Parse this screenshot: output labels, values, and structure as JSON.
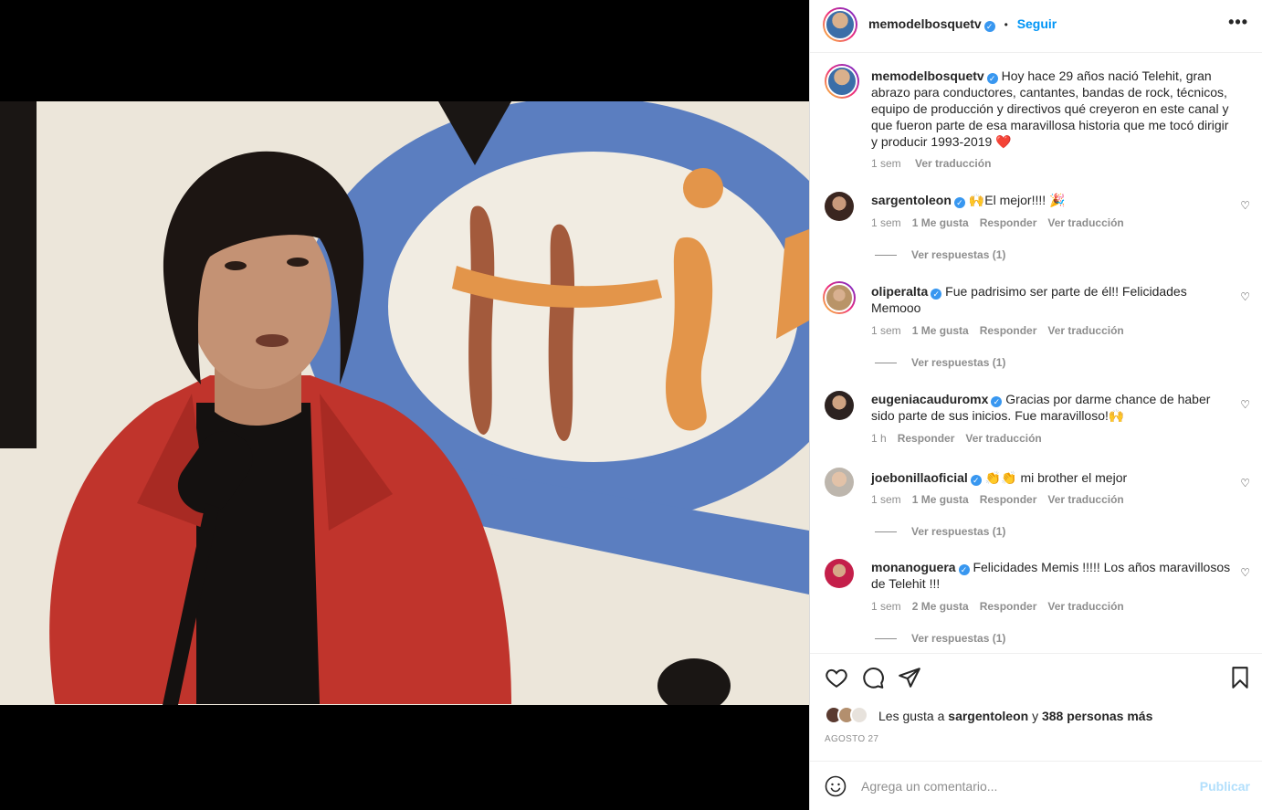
{
  "post": {
    "author": "memodelbosquetv",
    "follow_label": "Seguir",
    "dot": "•",
    "more_label": "•••"
  },
  "caption": {
    "author": "memodelbosquetv",
    "text": "Hoy hace 29 años nació Telehit, gran abrazo para conductores, cantantes, bandas de rock, técnicos, equipo de producción y directivos qué creyeron en este canal y que fueron parte de esa maravillosa historia que me tocó dirigir y producir 1993-2019 ❤️",
    "time": "1 sem",
    "translate": "Ver traducción"
  },
  "comments": [
    {
      "user": "sargentoleon",
      "text": "🙌El mejor!!!! 🎉",
      "time": "1 sem",
      "likes": "1 Me gusta",
      "reply": "Responder",
      "translate": "Ver traducción",
      "replies": "Ver respuestas (1)"
    },
    {
      "user": "oliperalta",
      "text": "Fue padrisimo ser parte de él!! Felicidades Memooo",
      "time": "1 sem",
      "likes": "1 Me gusta",
      "reply": "Responder",
      "translate": "Ver traducción",
      "replies": "Ver respuestas (1)"
    },
    {
      "user": "eugeniacauduromx",
      "text": "Gracias por darme chance de haber sido parte de sus inicios. Fue maravilloso!🙌",
      "time": "1 h",
      "likes": "",
      "reply": "Responder",
      "translate": "Ver traducción",
      "replies": ""
    },
    {
      "user": "joebonillaoficial",
      "text": "👏👏 mi brother el mejor",
      "time": "1 sem",
      "likes": "1 Me gusta",
      "reply": "Responder",
      "translate": "Ver traducción",
      "replies": "Ver respuestas (1)"
    },
    {
      "user": "monanoguera",
      "text": "Felicidades Memis !!!!! Los años maravillosos de Telehit !!!",
      "time": "1 sem",
      "likes": "2 Me gusta",
      "reply": "Responder",
      "translate": "Ver traducción",
      "replies": "Ver respuestas (1)"
    }
  ],
  "likes": {
    "prefix": "Les gusta a",
    "user": "sargentoleon",
    "joiner": "y",
    "others": "388 personas más"
  },
  "date": "AGOSTO 27",
  "composer": {
    "placeholder": "Agrega un comentario...",
    "post_label": "Publicar"
  },
  "icons": {
    "heart": "heart-icon",
    "comment": "comment-icon",
    "share": "share-icon",
    "save": "bookmark-icon",
    "emoji": "emoji-icon",
    "verified": "verified-badge-icon"
  },
  "colors": {
    "accent": "#0095f6",
    "muted": "#8e8e8e",
    "heart_red": "#ed4956"
  }
}
